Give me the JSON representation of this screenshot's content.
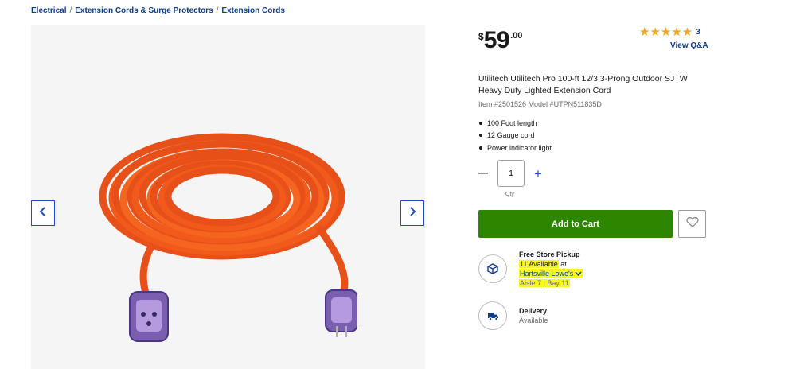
{
  "breadcrumb": {
    "items": [
      "Electrical",
      "Extension Cords & Surge Protectors",
      "Extension Cords"
    ],
    "separator": "/"
  },
  "price": {
    "currency": "$",
    "dollars": "59",
    "cents": ".00"
  },
  "rating": {
    "stars": "★★★★★",
    "count": "3",
    "qa_label": "View Q&A"
  },
  "product": {
    "title": "Utilitech Utilitech Pro 100-ft 12/3 3-Prong Outdoor SJTW Heavy Duty Lighted Extension Cord",
    "item_meta": "Item #2501526 Model #UTPN511835D",
    "features": [
      "100 Foot length",
      "12 Gauge cord",
      "Power indicator light"
    ]
  },
  "quantity": {
    "value": "1",
    "label": "Qty",
    "minus_icon": "minus-icon",
    "plus_icon": "plus-icon"
  },
  "cart": {
    "add_label": "Add to Cart",
    "wishlist_icon": "heart-icon"
  },
  "pickup": {
    "title": "Free Store Pickup",
    "available_count": "11 Available",
    "available_suffix": "at",
    "store": "Hartsville Lowe's",
    "aisle": "Aisle 7 | Bay 11",
    "icon": "box-icon"
  },
  "delivery": {
    "title": "Delivery",
    "status": "Available",
    "icon": "truck-icon"
  },
  "gallery": {
    "prev_icon": "chevron-left-icon",
    "next_icon": "chevron-right-icon"
  },
  "colors": {
    "link": "#0f3b8c",
    "accent_blue": "#1f4fbf",
    "cart_green": "#2d8500",
    "star": "#f3a61b",
    "highlight": "#f7f71a",
    "cord_orange": "#f25a1b"
  }
}
